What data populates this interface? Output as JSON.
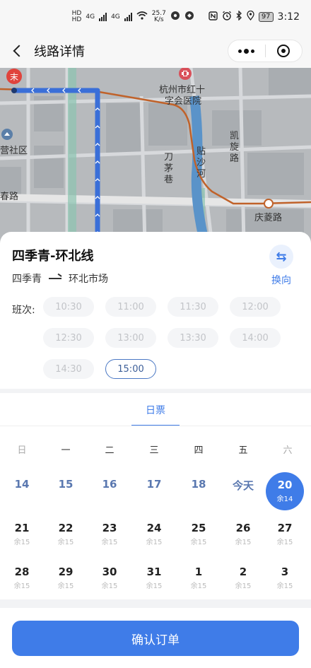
{
  "status_bar": {
    "hd1": "HD",
    "hd2": "HD",
    "net_speed_value": "25.7",
    "net_speed_unit": "K/s",
    "signal1": "4G",
    "signal2": "4G",
    "battery": "97",
    "time": "3:12"
  },
  "nav": {
    "title": "线路详情"
  },
  "map": {
    "labels": {
      "end_marker": "末",
      "hospital_line1": "杭州市红十",
      "hospital_line2": "字会医院",
      "community": "营社区",
      "daomao_1": "刀",
      "daomao_2": "茅",
      "daomao_3": "巷",
      "river_1": "贴",
      "river_2": "沙",
      "river_3": "河",
      "kaixuan_1": "凯",
      "kaixuan_2": "旋",
      "kaixuan_3": "路",
      "road_left": "春路",
      "qingling": "庆菱路"
    },
    "colors": {
      "route": "#3a6fd8",
      "metro": "#c0622a",
      "river": "#5a93c9",
      "green": "#8cc4b0"
    }
  },
  "route": {
    "name": "四季青-环北线",
    "from": "四季青",
    "to": "环北市场",
    "swap_label": "换向",
    "times_label": "班次:",
    "times": [
      {
        "label": "10:30",
        "selected": false
      },
      {
        "label": "11:00",
        "selected": false
      },
      {
        "label": "11:30",
        "selected": false
      },
      {
        "label": "12:00",
        "selected": false
      },
      {
        "label": "12:30",
        "selected": false
      },
      {
        "label": "13:00",
        "selected": false
      },
      {
        "label": "13:30",
        "selected": false
      },
      {
        "label": "14:00",
        "selected": false
      },
      {
        "label": "14:30",
        "selected": false
      },
      {
        "label": "15:00",
        "selected": true
      }
    ]
  },
  "calendar": {
    "tab": "日票",
    "weekdays": [
      "日",
      "一",
      "二",
      "三",
      "四",
      "五",
      "六"
    ],
    "rows": [
      [
        {
          "day": "14",
          "sub": "",
          "state": "past"
        },
        {
          "day": "15",
          "sub": "",
          "state": "past"
        },
        {
          "day": "16",
          "sub": "",
          "state": "past"
        },
        {
          "day": "17",
          "sub": "",
          "state": "past"
        },
        {
          "day": "18",
          "sub": "",
          "state": "past"
        },
        {
          "day": "今天",
          "sub": "",
          "state": "past"
        },
        {
          "day": "20",
          "sub": "余14",
          "state": "selected"
        }
      ],
      [
        {
          "day": "21",
          "sub": "余15",
          "state": "normal"
        },
        {
          "day": "22",
          "sub": "余15",
          "state": "normal"
        },
        {
          "day": "23",
          "sub": "余15",
          "state": "normal"
        },
        {
          "day": "24",
          "sub": "余15",
          "state": "normal"
        },
        {
          "day": "25",
          "sub": "余15",
          "state": "normal"
        },
        {
          "day": "26",
          "sub": "余15",
          "state": "normal"
        },
        {
          "day": "27",
          "sub": "余15",
          "state": "normal"
        }
      ],
      [
        {
          "day": "28",
          "sub": "余15",
          "state": "normal"
        },
        {
          "day": "29",
          "sub": "余15",
          "state": "normal"
        },
        {
          "day": "30",
          "sub": "余15",
          "state": "normal"
        },
        {
          "day": "31",
          "sub": "余15",
          "state": "normal"
        },
        {
          "day": "1",
          "sub": "余15",
          "state": "normal"
        },
        {
          "day": "2",
          "sub": "余15",
          "state": "normal"
        },
        {
          "day": "3",
          "sub": "余15",
          "state": "normal"
        }
      ]
    ]
  },
  "confirm_label": "确认订单",
  "colors": {
    "accent": "#3f7ce8",
    "selected_border": "#4a78c4"
  }
}
